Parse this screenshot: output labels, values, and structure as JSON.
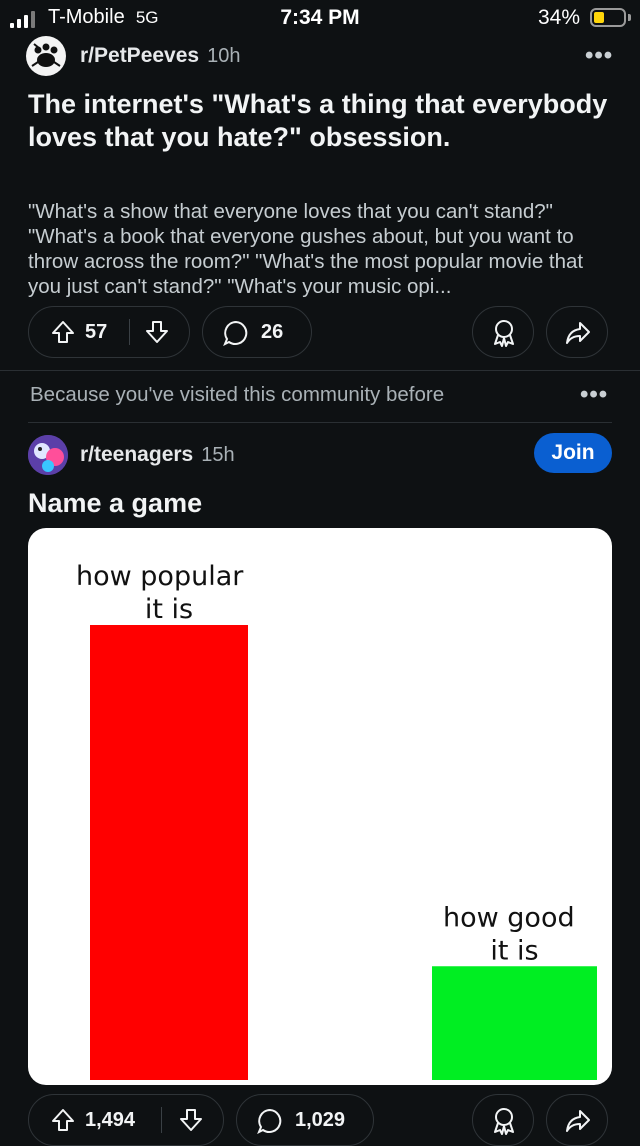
{
  "status_bar": {
    "carrier": "T-Mobile",
    "network": "5G",
    "time": "7:34 PM",
    "battery": "34%",
    "battery_level": 0.34
  },
  "post1": {
    "subreddit": "r/PetPeeves",
    "age": "10h",
    "more": "•••",
    "title": "The internet's \"What's a thing that everybody loves that you hate?\" obsession.",
    "body": "\"What's a show that everyone loves that you can't stand?\" \"What's a book that everyone gushes about, but you want to throw across the room?\" \"What's the most popular movie that you just can't stand?\" \"What's your music opi...",
    "upvotes": "57",
    "comments": "26"
  },
  "recommendation": {
    "reason": "Because you've visited this community before",
    "more": "•••"
  },
  "post2": {
    "subreddit": "r/teenagers",
    "age": "15h",
    "join_label": "Join",
    "title": "Name a game",
    "upvotes": "1,494",
    "comments": "1,029"
  },
  "colors": {
    "background": "#0e1113",
    "join": "#0a5fd1",
    "bar_popular": "#ff0000",
    "bar_good": "#00ee22"
  },
  "chart_data": {
    "type": "bar",
    "categories": [
      "how popular it is",
      "how good it is"
    ],
    "values": [
      100,
      25
    ],
    "ylim": [
      0,
      100
    ],
    "grid": false,
    "legend": "none",
    "title": "",
    "xlabel": "",
    "ylabel": "",
    "label_lines": [
      [
        "how popular",
        "it is"
      ],
      [
        "how good",
        "it is"
      ]
    ]
  }
}
